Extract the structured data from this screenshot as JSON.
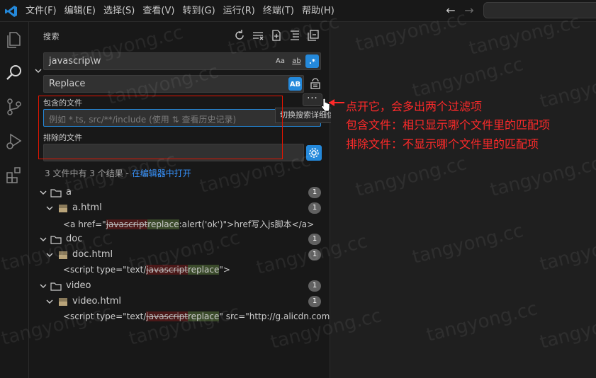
{
  "menu": [
    "文件(F)",
    "编辑(E)",
    "选择(S)",
    "查看(V)",
    "转到(G)",
    "运行(R)",
    "终端(T)",
    "帮助(H)"
  ],
  "sidebar": {
    "title": "搜索",
    "search_value": "javascrip\\w",
    "replace_value": "Replace",
    "match_case_label": "Aa",
    "whole_word_label": "ab",
    "regex_label": ".*",
    "preserve_case_label": "AB",
    "include_label": "包含的文件",
    "include_placeholder": "例如 *.ts, src/**/include (使用 ⇅ 查看历史记录)",
    "exclude_label": "排除的文件",
    "more_button": "···",
    "tooltip": "切换搜索详细信息",
    "summary_text": "3 文件中有 3 个结果 - ",
    "summary_link": "在编辑器中打开"
  },
  "results": [
    {
      "folder": "a",
      "file": "a.html",
      "count": "1",
      "pre": "<a href=\"",
      "del": "javascript",
      "ins": "replace",
      "post": ":alert('ok')\">href写入js脚本</a>"
    },
    {
      "folder": "doc",
      "file": "doc.html",
      "count": "1",
      "pre": "<script type=\"text/",
      "del": "javascript",
      "ins": "replace",
      "post": "\">"
    },
    {
      "folder": "video",
      "file": "video.html",
      "count": "1",
      "pre": "<script type=\"text/",
      "del": "javascript",
      "ins": "replace",
      "post": "\" src=\"http://g.alicdn.com/..."
    }
  ],
  "annotation": {
    "line1": "点开它，会多出两个过滤项",
    "line2": "包含文件：相只显示哪个文件里的匹配项",
    "line3": "排除文件：不显示哪个文件里的匹配项"
  },
  "watermark": "tangyong.cc",
  "colors": {
    "accent": "#2489db",
    "annotation_red": "#ff2a2a",
    "link": "#3794ff"
  }
}
